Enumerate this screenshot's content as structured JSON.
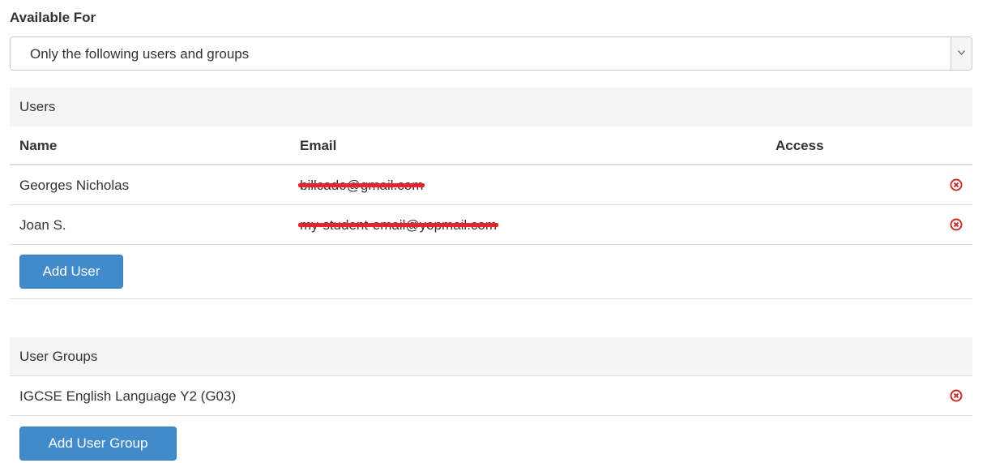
{
  "available_for": {
    "label": "Available For",
    "select_value": "Only the following users and groups"
  },
  "users": {
    "header": "Users",
    "columns": {
      "name": "Name",
      "email": "Email",
      "access": "Access"
    },
    "rows": [
      {
        "name": "Georges Nicholas",
        "email": "billcado@gmail.com",
        "access": ""
      },
      {
        "name": "Joan S.",
        "email": "my-student-email@yopmail.com",
        "access": ""
      }
    ],
    "add_label": "Add User"
  },
  "user_groups": {
    "header": "User Groups",
    "rows": [
      {
        "name": "IGCSE English Language Y2 (G03)"
      }
    ],
    "add_label": "Add User Group"
  },
  "colors": {
    "primary_button": "#428bca",
    "remove_icon": "#c9302c",
    "redaction": "#e8232b",
    "section_header_bg": "#f5f5f5"
  },
  "icons": {
    "remove": "remove-circle-icon",
    "select_arrow": "chevron-down-icon"
  }
}
